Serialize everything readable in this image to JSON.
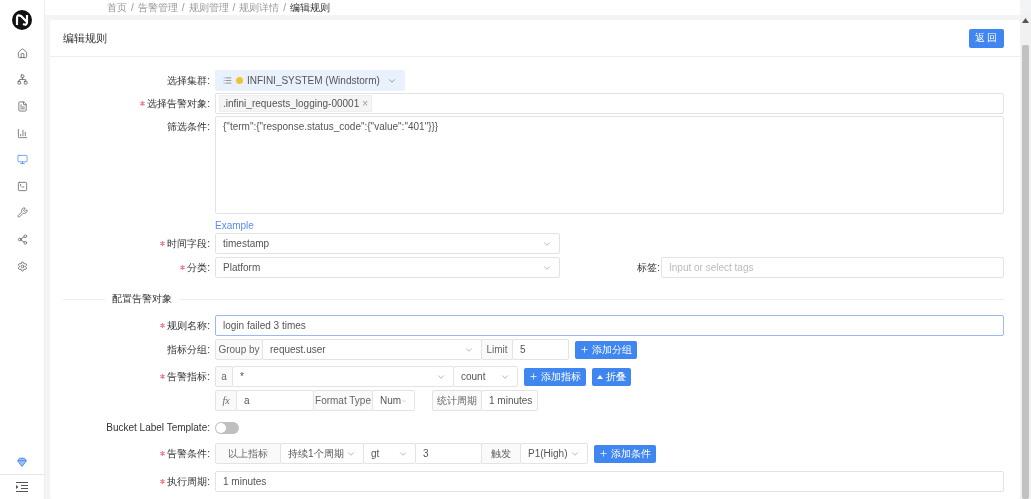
{
  "breadcrumb": {
    "separator": "/",
    "items": [
      "首页",
      "告警管理",
      "规则管理",
      "规则详情",
      "编辑规则"
    ]
  },
  "sidebar": {
    "items": [
      {
        "kind": "home",
        "selected": false
      },
      {
        "kind": "cluster",
        "selected": false
      },
      {
        "kind": "document",
        "selected": false
      },
      {
        "kind": "chart",
        "selected": false
      },
      {
        "kind": "monitor",
        "selected": true
      },
      {
        "kind": "terminal",
        "selected": false
      },
      {
        "kind": "wrench",
        "selected": false
      },
      {
        "kind": "share",
        "selected": false
      },
      {
        "kind": "settings",
        "selected": false
      }
    ],
    "bottom": [
      {
        "kind": "gem"
      },
      {
        "kind": "indent"
      }
    ]
  },
  "page": {
    "title": "编辑规则",
    "back_button": "返回"
  },
  "form": [
    {
      "kind": "field",
      "label": "选择集群:",
      "required": false,
      "controls": [
        {
          "kind": "cluster-select",
          "value": "INFINI_SYSTEM (Windstorm)"
        }
      ]
    },
    {
      "kind": "field",
      "label": "选择告警对象:",
      "required": true,
      "controls": [
        {
          "kind": "tag-input",
          "tags": [
            {
              "label": ".infini_requests_logging-00001",
              "remove": "×"
            }
          ]
        }
      ]
    },
    {
      "kind": "field",
      "label": "筛选条件:",
      "required": false,
      "controls": [
        {
          "kind": "textarea",
          "value": "{\"term\":{\"response.status_code\":{\"value\":\"401\"}}}"
        }
      ]
    },
    {
      "kind": "field",
      "required": false,
      "controls": [
        {
          "kind": "link",
          "label": "Example"
        }
      ]
    },
    {
      "kind": "field",
      "label": "时间字段:",
      "required": true,
      "controls": [
        {
          "kind": "select",
          "value": "timestamp"
        }
      ]
    },
    {
      "kind": "field",
      "label": "分类:",
      "required": true,
      "controls": [
        {
          "kind": "select",
          "value": "Platform"
        },
        {
          "kind": "label",
          "label": "标签:"
        },
        {
          "kind": "input",
          "placeholder": "Input or select tags",
          "focused": false
        }
      ]
    },
    {
      "kind": "section",
      "title": "配置告警对象"
    },
    {
      "kind": "field",
      "label": "规则名称:",
      "required": true,
      "controls": [
        {
          "kind": "input",
          "value": "login failed 3 times",
          "focused": true
        }
      ]
    },
    {
      "kind": "field",
      "label": "指标分组:",
      "required": false,
      "controls": [
        {
          "kind": "addon",
          "label": "Group by"
        },
        {
          "kind": "select",
          "value": "request.user"
        },
        {
          "kind": "addon",
          "label": "Limit"
        },
        {
          "kind": "input",
          "value": "5",
          "focused": false
        },
        {
          "kind": "add-button",
          "label": "添加分组"
        }
      ]
    },
    {
      "kind": "field",
      "label": "告警指标:",
      "required": true,
      "controls": [
        {
          "kind": "addon",
          "label": "a"
        },
        {
          "kind": "select",
          "value": "*"
        },
        {
          "kind": "select",
          "value": "count"
        },
        {
          "kind": "add-button",
          "label": "添加指标"
        },
        {
          "kind": "collapse-button",
          "label": "折叠"
        }
      ]
    },
    {
      "kind": "field",
      "required": false,
      "controls": [
        {
          "kind": "formula-addon",
          "label": "fx"
        },
        {
          "kind": "input",
          "value": "a",
          "focused": false
        },
        {
          "kind": "addon",
          "label": "Format Type"
        },
        {
          "kind": "select",
          "value": "Num"
        },
        {
          "kind": "addon",
          "label": "统计周期"
        },
        {
          "kind": "select",
          "value": "1 minutes"
        }
      ]
    },
    {
      "kind": "field",
      "label": "Bucket Label Template:",
      "required": false,
      "controls": [
        {
          "kind": "switch",
          "on": false
        }
      ]
    },
    {
      "kind": "field",
      "label": "告警条件:",
      "required": true,
      "controls": [
        {
          "kind": "addon",
          "label": "以上指标"
        },
        {
          "kind": "select",
          "value": "持续1个周期"
        },
        {
          "kind": "select",
          "value": "gt"
        },
        {
          "kind": "input",
          "value": "3",
          "focused": false
        },
        {
          "kind": "addon",
          "label": "触发"
        },
        {
          "kind": "select",
          "value": "P1(High)"
        },
        {
          "kind": "add-button",
          "label": "添加条件"
        }
      ]
    },
    {
      "kind": "field",
      "label": "执行周期:",
      "required": true,
      "controls": [
        {
          "kind": "input",
          "value": "1 minutes",
          "focused": false
        }
      ]
    }
  ]
}
